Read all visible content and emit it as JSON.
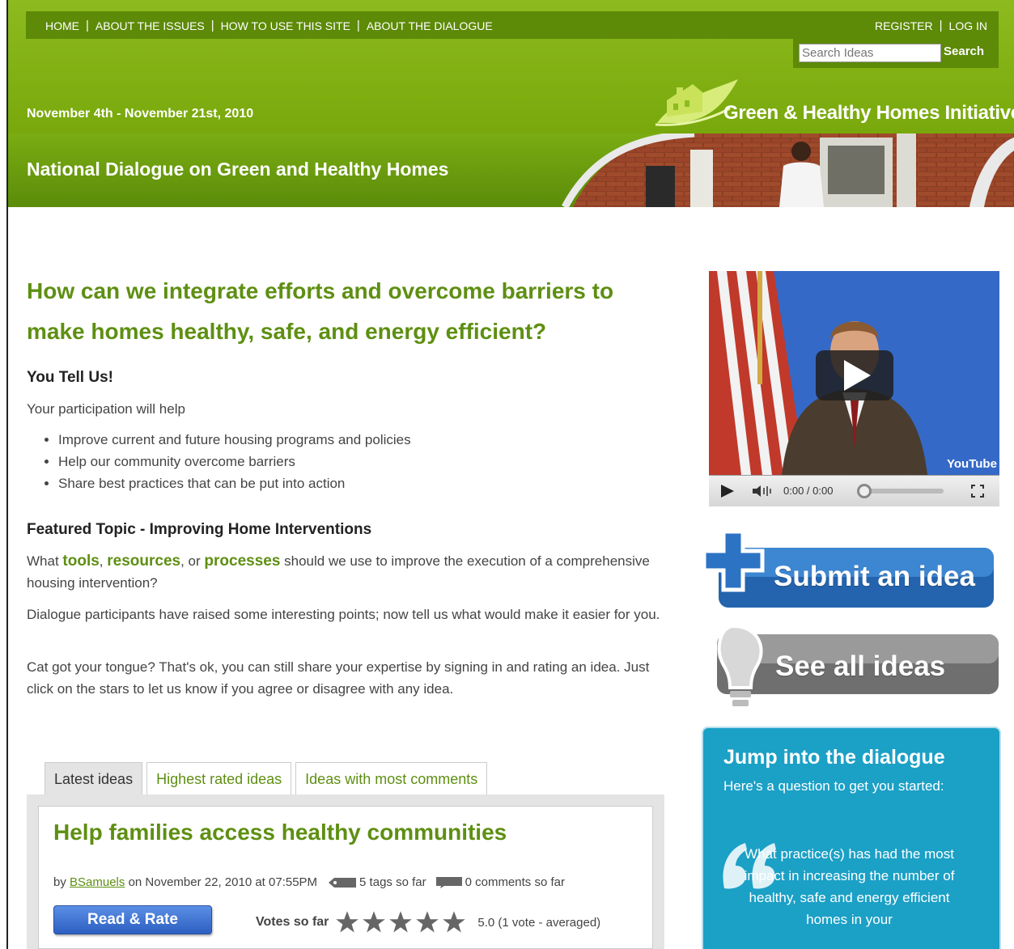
{
  "nav": {
    "left": [
      "HOME",
      "ABOUT THE ISSUES",
      "HOW TO USE THIS SITE",
      "ABOUT THE DIALOGUE"
    ],
    "right": [
      "REGISTER",
      "LOG IN"
    ]
  },
  "search": {
    "placeholder": "Search Ideas",
    "button": "Search"
  },
  "header": {
    "dates": "November 4th - November 21st, 2010",
    "logo_text": "Green & Healthy Homes Initiative",
    "banner_title": "National Dialogue on Green and Healthy Homes"
  },
  "main": {
    "headline": "How can we integrate efforts and overcome barriers to make homes healthy, safe, and energy efficient?",
    "tell_us": "You Tell Us!",
    "participation": "Your participation will help",
    "bullets": [
      "Improve current and future housing programs and policies",
      "Help our community overcome barriers",
      "Share best practices that can be put into action"
    ],
    "featured_heading": "Featured Topic - Improving Home Interventions",
    "featured_q": {
      "pre": "What ",
      "kw1": "tools",
      "sep1": ", ",
      "kw2": "resources",
      "sep2": ", or ",
      "kw3": "processes",
      "post": " should we use to improve the execution of a comprehensive housing intervention?"
    },
    "para2": "Dialogue participants have raised some interesting points; now tell us what would make it easier for you.",
    "para3": "Cat got your tongue? That's ok, you can still share your expertise by signing in and rating an idea. Just click on the stars to let us know if you agree or disagree with any idea."
  },
  "tabs": [
    "Latest ideas",
    "Highest rated ideas",
    "Ideas with most comments"
  ],
  "idea": {
    "title": "Help families access healthy communities",
    "by": "by",
    "author": "BSamuels",
    "date": "on November 22, 2010 at 07:55PM",
    "tags": "5 tags so far",
    "comments": "0 comments so far",
    "read_button": "Read & Rate",
    "votes_label": "Votes so far",
    "rating_text": "5.0 (1 vote - averaged)",
    "rating_value": 5
  },
  "video": {
    "time": "0:00 / 0:00",
    "brand": "YouTube"
  },
  "sidebar": {
    "submit": "Submit an idea",
    "see_all": "See all ideas",
    "jump_title": "Jump into the dialogue",
    "jump_sub": "Here's a question to get you started:",
    "jump_quote": "What practice(s) has had the most impact in increasing the number of healthy, safe and energy efficient homes in your"
  },
  "colors": {
    "green": "#78a80b",
    "nav_green": "#5d8a07",
    "heading_green": "#5e8f12",
    "blue": "#1ba0c6"
  }
}
